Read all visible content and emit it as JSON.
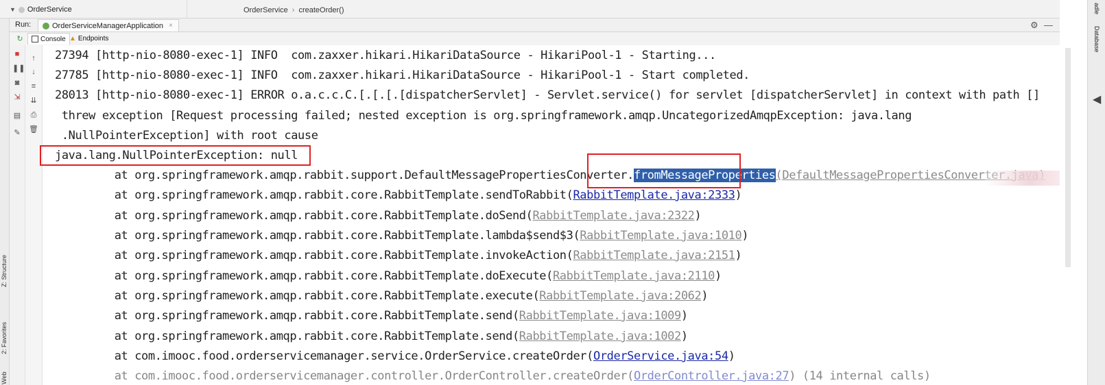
{
  "topbar": {
    "project_node": "OrderService",
    "breadcrumb": [
      "OrderService",
      "createOrder()"
    ]
  },
  "run_panel": {
    "run_label": "Run:",
    "tab_title": "OrderServiceManagerApplication",
    "subtabs": [
      "Console",
      "Endpoints"
    ]
  },
  "side_labels": {
    "structure": "Z: Structure",
    "favorites": "2: Favorites",
    "web": "Web",
    "right_top": "adle",
    "database": "Database"
  },
  "console": {
    "lines": [
      {
        "prefix": "27394 [http-nio-8080-exec-1] INFO  com.zaxxer.hikari.HikariDataSource - HikariPool-1 - Starting..."
      },
      {
        "prefix": "27785 [http-nio-8080-exec-1] INFO  com.zaxxer.hikari.HikariDataSource - HikariPool-1 - Start completed."
      },
      {
        "prefix": "28013 [http-nio-8080-exec-1] ERROR o.a.c.c.C.[.[.[.[dispatcherServlet] - Servlet.service() for servlet [dispatcherServlet] in context with path []"
      },
      {
        "prefix": " threw exception [Request processing failed; nested exception is org.springframework.amqp.UncategorizedAmqpException: java.lang"
      },
      {
        "prefix": " .NullPointerException] with root cause"
      },
      {
        "prefix": "java.lang.NullPointerException: null"
      },
      {
        "prefix": "\tat org.springframework.amqp.rabbit.support.DefaultMessagePropertiesConverter.",
        "selected": "fromMessageProperties",
        "link_open": "(",
        "link": "DefaultMessagePropertiesConverter.java",
        "link_close": ")"
      },
      {
        "prefix": "\tat org.springframework.amqp.rabbit.core.RabbitTemplate.sendToRabbit",
        "link_open": "(",
        "link": "RabbitTemplate.java:2333",
        "link_close": ")",
        "link_style": "active"
      },
      {
        "prefix": "\tat org.springframework.amqp.rabbit.core.RabbitTemplate.doSend",
        "link_open": "(",
        "link": "RabbitTemplate.java:2322",
        "link_close": ")"
      },
      {
        "prefix": "\tat org.springframework.amqp.rabbit.core.RabbitTemplate.lambda$send$3",
        "link_open": "(",
        "link": "RabbitTemplate.java:1010",
        "link_close": ")"
      },
      {
        "prefix": "\tat org.springframework.amqp.rabbit.core.RabbitTemplate.invokeAction",
        "link_open": "(",
        "link": "RabbitTemplate.java:2151",
        "link_close": ")"
      },
      {
        "prefix": "\tat org.springframework.amqp.rabbit.core.RabbitTemplate.doExecute",
        "link_open": "(",
        "link": "RabbitTemplate.java:2110",
        "link_close": ")"
      },
      {
        "prefix": "\tat org.springframework.amqp.rabbit.core.RabbitTemplate.execute",
        "link_open": "(",
        "link": "RabbitTemplate.java:2062",
        "link_close": ")"
      },
      {
        "prefix": "\tat org.springframework.amqp.rabbit.core.RabbitTemplate.send",
        "link_open": "(",
        "link": "RabbitTemplate.java:1009",
        "link_close": ")"
      },
      {
        "prefix": "\tat org.springframework.amqp.rabbit.core.RabbitTemplate.send",
        "link_open": "(",
        "link": "RabbitTemplate.java:1002",
        "link_close": ")"
      },
      {
        "prefix": "\tat com.imooc.food.orderservicemanager.service.OrderService.createOrder",
        "link_open": "(",
        "link": "OrderService.java:54",
        "link_close": ")",
        "link_style": "active"
      },
      {
        "prefix": "\tat com.imooc.food.orderservicemanager.controller.OrderController.createOrder",
        "link_open": "(",
        "link": "OrderController.java:27",
        "link_close": ") (14 internal calls)"
      }
    ]
  },
  "colors": {
    "highlight_box": "#e02020",
    "selection": "#2f5fa8",
    "link": "#1a27a8"
  }
}
